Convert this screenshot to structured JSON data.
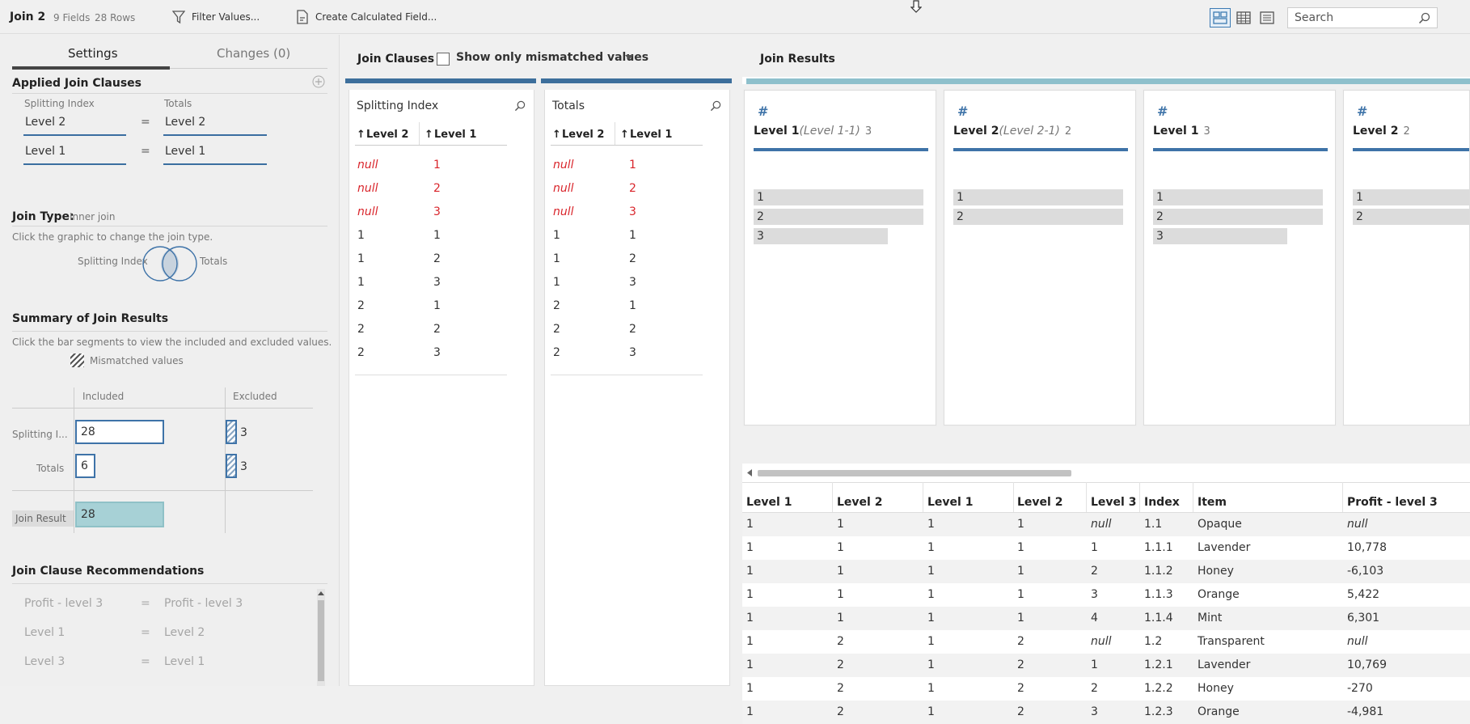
{
  "toolbar": {
    "title": "Join 2",
    "fields": "9 Fields",
    "rows": "28 Rows",
    "filter_label": "Filter Values...",
    "calc_label": "Create Calculated Field...",
    "search_placeholder": "Search"
  },
  "left": {
    "tabs": {
      "settings": "Settings",
      "changes": "Changes (0)"
    },
    "applied_title": "Applied Join Clauses",
    "left_source": "Splitting Index",
    "right_source": "Totals",
    "clauses": [
      {
        "left": "Level 2",
        "op": "=",
        "right": "Level 2"
      },
      {
        "left": "Level 1",
        "op": "=",
        "right": "Level 1"
      }
    ],
    "join_type_label": "Join Type:",
    "join_type_value": "Inner join",
    "join_type_help": "Click the graphic to change the join type.",
    "venn_left": "Splitting Index",
    "venn_right": "Totals",
    "summary_title": "Summary of Join Results",
    "summary_help": "Click the bar segments to view the included and excluded values.",
    "mismatched_label": "Mismatched values",
    "included_label": "Included",
    "excluded_label": "Excluded",
    "summary_rows": [
      {
        "label": "Splitting I...",
        "included": "28",
        "excluded": "3"
      },
      {
        "label": "Totals",
        "included": "6",
        "excluded": "3"
      }
    ],
    "join_result_label": "Join Result",
    "join_result_value": "28",
    "rec_title": "Join Clause Recommendations",
    "recommendations": [
      {
        "left": "Profit - level 3",
        "op": "=",
        "right": "Profit - level 3"
      },
      {
        "left": "Level 1",
        "op": "=",
        "right": "Level 2"
      },
      {
        "left": "Level 3",
        "op": "=",
        "right": "Level 1"
      }
    ]
  },
  "clauses_panel": {
    "title": "Join Clauses",
    "show_mismatched": "Show only mismatched values",
    "tables": [
      {
        "name": "Splitting Index",
        "col1": "Level 2",
        "col2": "Level 1",
        "rows": [
          [
            "null",
            "1"
          ],
          [
            "null",
            "2"
          ],
          [
            "null",
            "3"
          ],
          [
            "1",
            "1"
          ],
          [
            "1",
            "2"
          ],
          [
            "1",
            "3"
          ],
          [
            "2",
            "1"
          ],
          [
            "2",
            "2"
          ],
          [
            "2",
            "3"
          ]
        ]
      },
      {
        "name": "Totals",
        "col1": "Level 2",
        "col2": "Level 1",
        "rows": [
          [
            "null",
            "1"
          ],
          [
            "null",
            "2"
          ],
          [
            "null",
            "3"
          ],
          [
            "1",
            "1"
          ],
          [
            "1",
            "2"
          ],
          [
            "1",
            "3"
          ],
          [
            "2",
            "1"
          ],
          [
            "2",
            "2"
          ],
          [
            "2",
            "3"
          ]
        ]
      }
    ]
  },
  "results": {
    "title": "Join Results",
    "cards": [
      {
        "title": "Level 1",
        "sub": "(Level 1-1)",
        "count": "3",
        "values": [
          {
            "v": "1",
            "f": 1.0
          },
          {
            "v": "2",
            "f": 1.0
          },
          {
            "v": "3",
            "f": 0.79
          }
        ]
      },
      {
        "title": "Level 2",
        "sub": "(Level 2-1)",
        "count": "2",
        "values": [
          {
            "v": "1",
            "f": 1.0
          },
          {
            "v": "2",
            "f": 1.0
          }
        ]
      },
      {
        "title": "Level 1",
        "sub": "",
        "count": "3",
        "values": [
          {
            "v": "1",
            "f": 1.0
          },
          {
            "v": "2",
            "f": 1.0
          },
          {
            "v": "3",
            "f": 0.79
          }
        ]
      },
      {
        "title": "Level 2",
        "sub": "",
        "count": "2",
        "values": [
          {
            "v": "1",
            "f": 1.0
          },
          {
            "v": "2",
            "f": 1.0
          }
        ]
      }
    ],
    "grid_headers": [
      "Level 1",
      "Level 2",
      "Level 1",
      "Level 2",
      "Level 3",
      "Index",
      "Item",
      "Profit - level 3"
    ],
    "grid_rows": [
      [
        "1",
        "1",
        "1",
        "1",
        "null",
        "1.1",
        "Opaque",
        "null"
      ],
      [
        "1",
        "1",
        "1",
        "1",
        "1",
        "1.1.1",
        "Lavender",
        "10,778"
      ],
      [
        "1",
        "1",
        "1",
        "1",
        "2",
        "1.1.2",
        "Honey",
        "-6,103"
      ],
      [
        "1",
        "1",
        "1",
        "1",
        "3",
        "1.1.3",
        "Orange",
        "5,422"
      ],
      [
        "1",
        "1",
        "1",
        "1",
        "4",
        "1.1.4",
        "Mint",
        "6,301"
      ],
      [
        "1",
        "2",
        "1",
        "2",
        "null",
        "1.2",
        "Transparent",
        "null"
      ],
      [
        "1",
        "2",
        "1",
        "2",
        "1",
        "1.2.1",
        "Lavender",
        "10,769"
      ],
      [
        "1",
        "2",
        "1",
        "2",
        "2",
        "1.2.2",
        "Honey",
        "-270"
      ],
      [
        "1",
        "2",
        "1",
        "2",
        "3",
        "1.2.3",
        "Orange",
        "-4,981"
      ]
    ]
  },
  "colors": {
    "accent": "#3e73a8",
    "null_red": "#d9252b",
    "result_teal": "#a7d1d6"
  }
}
